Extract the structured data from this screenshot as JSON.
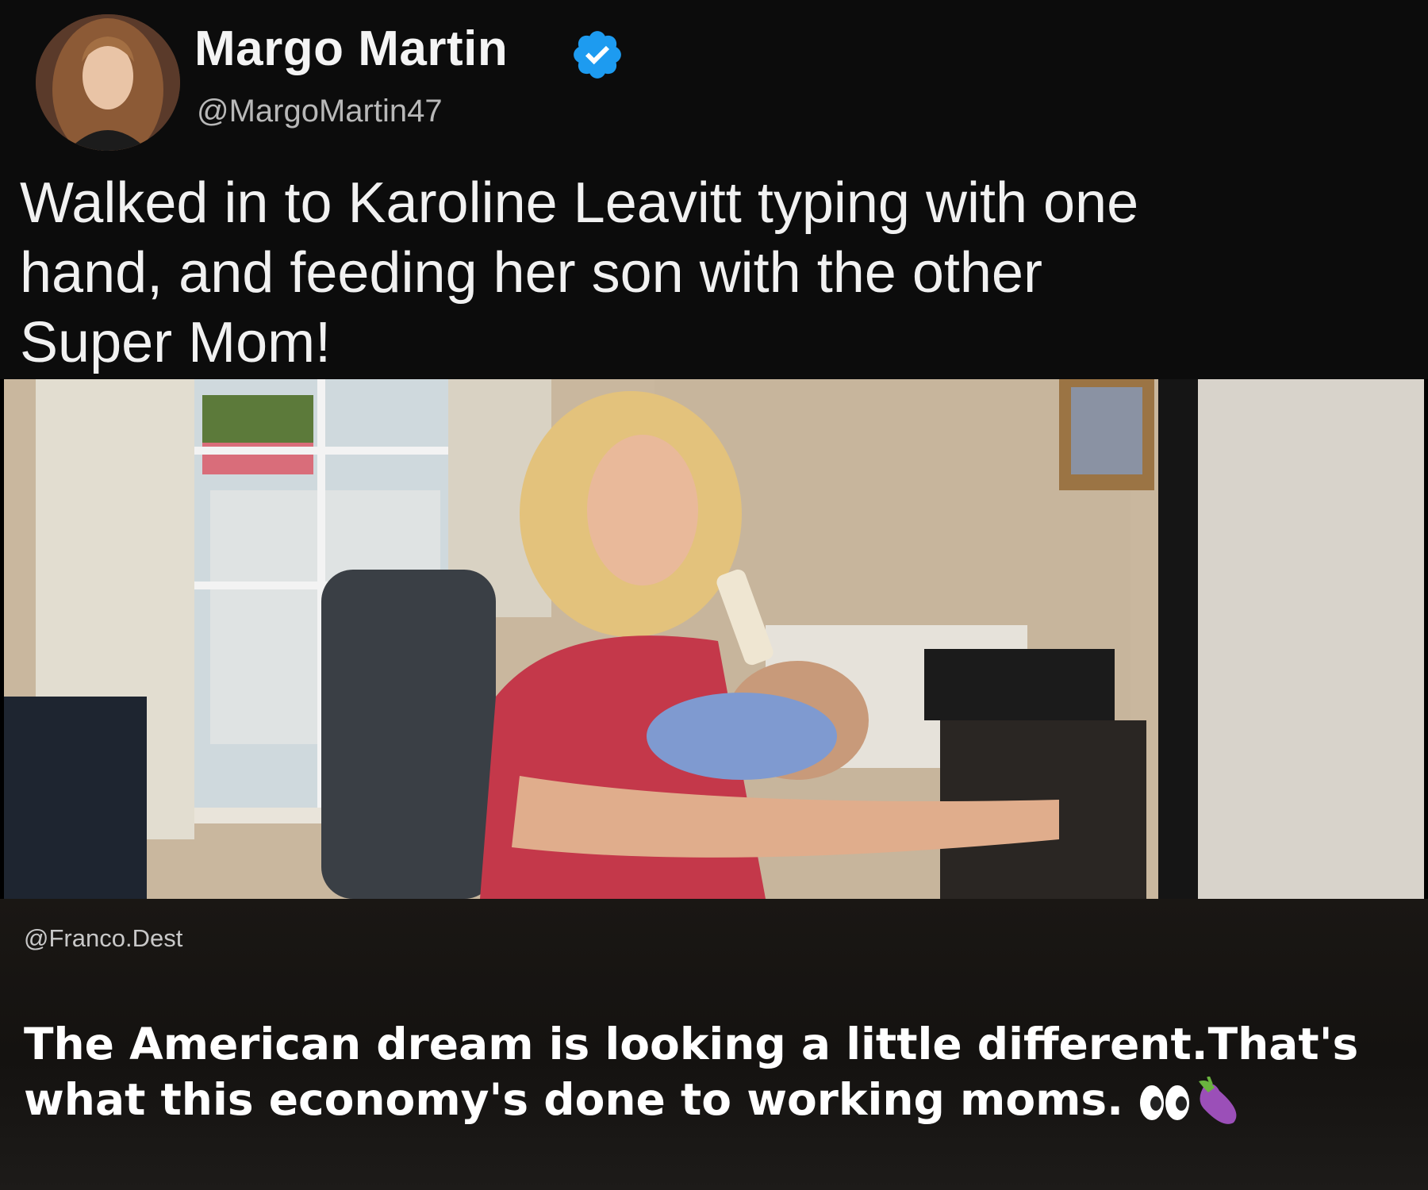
{
  "tweet": {
    "author_name": "Margo Martin",
    "author_handle": "@MargoMartin47",
    "verified": true,
    "verified_icon": "verified-badge-icon",
    "text_lines": [
      "Walked in to Karoline Leavitt typing with one",
      "hand, and feeding her son with the other",
      "Super Mom!"
    ]
  },
  "photo": {
    "subject": "photo-office-mother-feeding-baby"
  },
  "overlay": {
    "credit": "@Franco.Dest",
    "caption_lines": [
      "The American dream is looking a little different.That's",
      "what this economy's done to working moms."
    ],
    "emojis": [
      "eyes-icon",
      "eggplant-icon"
    ]
  },
  "colors": {
    "verified_blue": "#1d9bf0",
    "background": "#0c0c0c"
  }
}
